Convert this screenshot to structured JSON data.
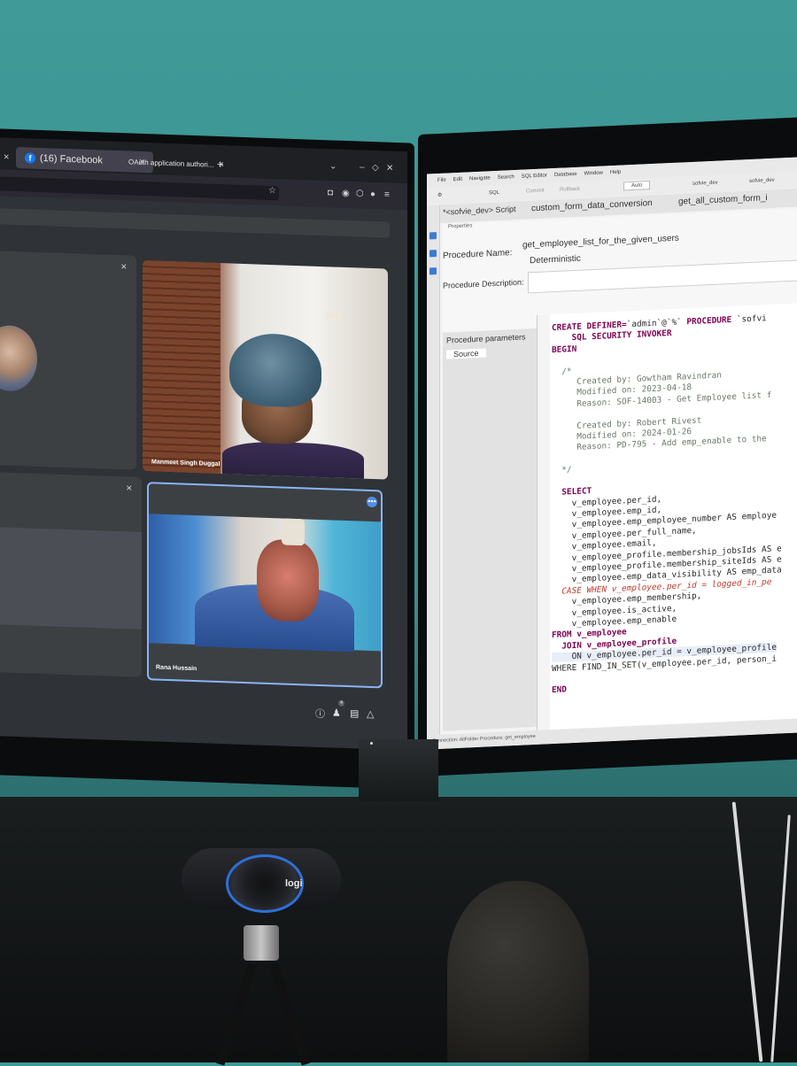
{
  "browser": {
    "tabs": [
      {
        "label": "(16) Facebook"
      },
      {
        "label": "OAuth application authori..."
      }
    ],
    "new_tab": "+",
    "tab_close": "×",
    "window_controls": [
      "⌄",
      "–",
      "◇",
      "✕"
    ]
  },
  "meeting": {
    "participants": [
      {
        "name": "Manmeet Singh Duggal"
      },
      {
        "name": "Rana Hussain"
      }
    ],
    "more_button": "•••",
    "mute_icon": "mic-off-icon",
    "participants_count": "4"
  },
  "ide": {
    "menu": [
      "File",
      "Edit",
      "Navigate",
      "Search",
      "SQL Editor",
      "Database",
      "Window",
      "Help"
    ],
    "toolbar": {
      "sql_label": "SQL",
      "commit_label": "Commit",
      "rollback_label": "Rollback",
      "mode_value": "Auto",
      "datasource_1": "sofvie_dev",
      "datasource_2": "sofvie_dev"
    },
    "tabs": [
      {
        "label": "*<sofvie_dev> Script"
      },
      {
        "label": "custom_form_data_conversion"
      },
      {
        "label": "get_all_custom_form_i"
      }
    ],
    "properties_label": "Properties",
    "procedure_name_label": "Procedure Name:",
    "procedure_name_value": "get_employee_list_for_the_given_users",
    "deterministic_value": "Deterministic",
    "procedure_description_label": "Procedure Description:",
    "side_tabs": [
      {
        "label": "Procedure parameters"
      },
      {
        "label": "Source"
      }
    ],
    "status_text": "Connection: AllFolder  Procedure: get_employee"
  },
  "code_lines": [
    {
      "kw": "CREATE DEFINER=",
      "text": "`admin`@`%` ",
      "kw2": "PROCEDURE",
      "tail": " `sofvi"
    },
    {
      "kw": "    SQL SECURITY INVOKER",
      "text": "",
      "kw2": "",
      "tail": ""
    },
    {
      "kw": "BEGIN",
      "text": "",
      "kw2": "",
      "tail": ""
    }
  ],
  "comment_lines": [
    "  /*",
    "     Created by: Gowtham Ravindran",
    "     Modified on: 2023-04-18",
    "     Reason: SOF-14003 - Get Employee list f",
    "",
    "     Created by: Robert Rivest",
    "     Modified on: 2024-01-26",
    "     Reason: PD-795 - Add emp_enable to the",
    "",
    "  */"
  ],
  "select_lines": [
    "  SELECT",
    "    v_employee.per_id,",
    "    v_employee.emp_id,",
    "    v_employee.emp_employee_number AS employe",
    "    v_employee.per_full_name,",
    "    v_employee.email,",
    "    v_employee_profile.membership_jobsIds AS e",
    "    v_employee_profile.membership_siteIds AS e",
    "    v_employee.emp_data_visibility AS emp_data",
    "  CASE WHEN v_employee.per_id = logged_in_pe",
    "    v_employee.emp_membership,",
    "    v_employee.is_active,",
    "    v_employee.emp_enable",
    "FROM v_employee",
    "  JOIN v_employee_profile",
    "    ON v_employee.per_id = v_employee_profile",
    "WHERE FIND_IN_SET(v_employee.per_id, person_i",
    "",
    "END"
  ],
  "webcam": {
    "brand": "logi"
  }
}
